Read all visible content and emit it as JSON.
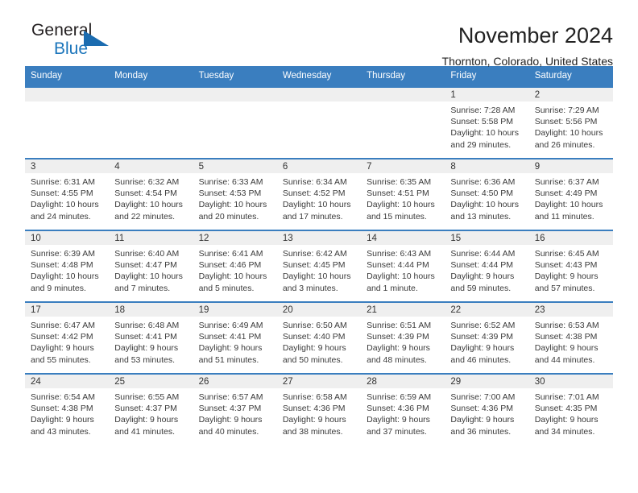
{
  "brand": {
    "name_top": "General",
    "name_bottom": "Blue",
    "triangle_icon": "triangle-icon",
    "color_dark": "#231f20",
    "color_blue": "#1b75bb"
  },
  "header": {
    "title": "November 2024",
    "subtitle": "Thornton, Colorado, United States"
  },
  "colors": {
    "header_row": "#3a7ebf",
    "daynum_bar": "#efefef",
    "cell_border": "#3a7ebf",
    "text": "#3a3a3a"
  },
  "weekday_headers": [
    "Sunday",
    "Monday",
    "Tuesday",
    "Wednesday",
    "Thursday",
    "Friday",
    "Saturday"
  ],
  "labels": {
    "sunrise_prefix": "Sunrise:",
    "sunset_prefix": "Sunset:",
    "daylight_prefix": "Daylight:"
  },
  "weeks": [
    [
      {
        "day": "",
        "sunrise": "",
        "sunset": "",
        "daylight": "",
        "empty": true
      },
      {
        "day": "",
        "sunrise": "",
        "sunset": "",
        "daylight": "",
        "empty": true
      },
      {
        "day": "",
        "sunrise": "",
        "sunset": "",
        "daylight": "",
        "empty": true
      },
      {
        "day": "",
        "sunrise": "",
        "sunset": "",
        "daylight": "",
        "empty": true
      },
      {
        "day": "",
        "sunrise": "",
        "sunset": "",
        "daylight": "",
        "empty": true
      },
      {
        "day": "1",
        "sunrise": "Sunrise: 7:28 AM",
        "sunset": "Sunset: 5:58 PM",
        "daylight": "Daylight: 10 hours and 29 minutes."
      },
      {
        "day": "2",
        "sunrise": "Sunrise: 7:29 AM",
        "sunset": "Sunset: 5:56 PM",
        "daylight": "Daylight: 10 hours and 26 minutes."
      }
    ],
    [
      {
        "day": "3",
        "sunrise": "Sunrise: 6:31 AM",
        "sunset": "Sunset: 4:55 PM",
        "daylight": "Daylight: 10 hours and 24 minutes."
      },
      {
        "day": "4",
        "sunrise": "Sunrise: 6:32 AM",
        "sunset": "Sunset: 4:54 PM",
        "daylight": "Daylight: 10 hours and 22 minutes."
      },
      {
        "day": "5",
        "sunrise": "Sunrise: 6:33 AM",
        "sunset": "Sunset: 4:53 PM",
        "daylight": "Daylight: 10 hours and 20 minutes."
      },
      {
        "day": "6",
        "sunrise": "Sunrise: 6:34 AM",
        "sunset": "Sunset: 4:52 PM",
        "daylight": "Daylight: 10 hours and 17 minutes."
      },
      {
        "day": "7",
        "sunrise": "Sunrise: 6:35 AM",
        "sunset": "Sunset: 4:51 PM",
        "daylight": "Daylight: 10 hours and 15 minutes."
      },
      {
        "day": "8",
        "sunrise": "Sunrise: 6:36 AM",
        "sunset": "Sunset: 4:50 PM",
        "daylight": "Daylight: 10 hours and 13 minutes."
      },
      {
        "day": "9",
        "sunrise": "Sunrise: 6:37 AM",
        "sunset": "Sunset: 4:49 PM",
        "daylight": "Daylight: 10 hours and 11 minutes."
      }
    ],
    [
      {
        "day": "10",
        "sunrise": "Sunrise: 6:39 AM",
        "sunset": "Sunset: 4:48 PM",
        "daylight": "Daylight: 10 hours and 9 minutes."
      },
      {
        "day": "11",
        "sunrise": "Sunrise: 6:40 AM",
        "sunset": "Sunset: 4:47 PM",
        "daylight": "Daylight: 10 hours and 7 minutes."
      },
      {
        "day": "12",
        "sunrise": "Sunrise: 6:41 AM",
        "sunset": "Sunset: 4:46 PM",
        "daylight": "Daylight: 10 hours and 5 minutes."
      },
      {
        "day": "13",
        "sunrise": "Sunrise: 6:42 AM",
        "sunset": "Sunset: 4:45 PM",
        "daylight": "Daylight: 10 hours and 3 minutes."
      },
      {
        "day": "14",
        "sunrise": "Sunrise: 6:43 AM",
        "sunset": "Sunset: 4:44 PM",
        "daylight": "Daylight: 10 hours and 1 minute."
      },
      {
        "day": "15",
        "sunrise": "Sunrise: 6:44 AM",
        "sunset": "Sunset: 4:44 PM",
        "daylight": "Daylight: 9 hours and 59 minutes."
      },
      {
        "day": "16",
        "sunrise": "Sunrise: 6:45 AM",
        "sunset": "Sunset: 4:43 PM",
        "daylight": "Daylight: 9 hours and 57 minutes."
      }
    ],
    [
      {
        "day": "17",
        "sunrise": "Sunrise: 6:47 AM",
        "sunset": "Sunset: 4:42 PM",
        "daylight": "Daylight: 9 hours and 55 minutes."
      },
      {
        "day": "18",
        "sunrise": "Sunrise: 6:48 AM",
        "sunset": "Sunset: 4:41 PM",
        "daylight": "Daylight: 9 hours and 53 minutes."
      },
      {
        "day": "19",
        "sunrise": "Sunrise: 6:49 AM",
        "sunset": "Sunset: 4:41 PM",
        "daylight": "Daylight: 9 hours and 51 minutes."
      },
      {
        "day": "20",
        "sunrise": "Sunrise: 6:50 AM",
        "sunset": "Sunset: 4:40 PM",
        "daylight": "Daylight: 9 hours and 50 minutes."
      },
      {
        "day": "21",
        "sunrise": "Sunrise: 6:51 AM",
        "sunset": "Sunset: 4:39 PM",
        "daylight": "Daylight: 9 hours and 48 minutes."
      },
      {
        "day": "22",
        "sunrise": "Sunrise: 6:52 AM",
        "sunset": "Sunset: 4:39 PM",
        "daylight": "Daylight: 9 hours and 46 minutes."
      },
      {
        "day": "23",
        "sunrise": "Sunrise: 6:53 AM",
        "sunset": "Sunset: 4:38 PM",
        "daylight": "Daylight: 9 hours and 44 minutes."
      }
    ],
    [
      {
        "day": "24",
        "sunrise": "Sunrise: 6:54 AM",
        "sunset": "Sunset: 4:38 PM",
        "daylight": "Daylight: 9 hours and 43 minutes."
      },
      {
        "day": "25",
        "sunrise": "Sunrise: 6:55 AM",
        "sunset": "Sunset: 4:37 PM",
        "daylight": "Daylight: 9 hours and 41 minutes."
      },
      {
        "day": "26",
        "sunrise": "Sunrise: 6:57 AM",
        "sunset": "Sunset: 4:37 PM",
        "daylight": "Daylight: 9 hours and 40 minutes."
      },
      {
        "day": "27",
        "sunrise": "Sunrise: 6:58 AM",
        "sunset": "Sunset: 4:36 PM",
        "daylight": "Daylight: 9 hours and 38 minutes."
      },
      {
        "day": "28",
        "sunrise": "Sunrise: 6:59 AM",
        "sunset": "Sunset: 4:36 PM",
        "daylight": "Daylight: 9 hours and 37 minutes."
      },
      {
        "day": "29",
        "sunrise": "Sunrise: 7:00 AM",
        "sunset": "Sunset: 4:36 PM",
        "daylight": "Daylight: 9 hours and 36 minutes."
      },
      {
        "day": "30",
        "sunrise": "Sunrise: 7:01 AM",
        "sunset": "Sunset: 4:35 PM",
        "daylight": "Daylight: 9 hours and 34 minutes."
      }
    ]
  ]
}
